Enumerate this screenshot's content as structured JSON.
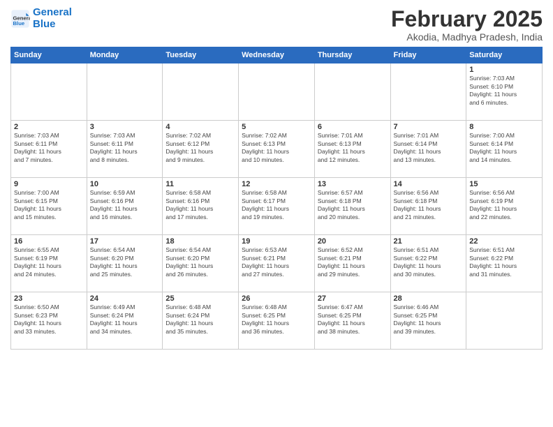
{
  "header": {
    "logo_line1": "General",
    "logo_line2": "Blue",
    "month": "February 2025",
    "location": "Akodia, Madhya Pradesh, India"
  },
  "weekdays": [
    "Sunday",
    "Monday",
    "Tuesday",
    "Wednesday",
    "Thursday",
    "Friday",
    "Saturday"
  ],
  "weeks": [
    [
      {
        "day": "",
        "info": ""
      },
      {
        "day": "",
        "info": ""
      },
      {
        "day": "",
        "info": ""
      },
      {
        "day": "",
        "info": ""
      },
      {
        "day": "",
        "info": ""
      },
      {
        "day": "",
        "info": ""
      },
      {
        "day": "1",
        "info": "Sunrise: 7:03 AM\nSunset: 6:10 PM\nDaylight: 11 hours\nand 6 minutes."
      }
    ],
    [
      {
        "day": "2",
        "info": "Sunrise: 7:03 AM\nSunset: 6:11 PM\nDaylight: 11 hours\nand 7 minutes."
      },
      {
        "day": "3",
        "info": "Sunrise: 7:03 AM\nSunset: 6:11 PM\nDaylight: 11 hours\nand 8 minutes."
      },
      {
        "day": "4",
        "info": "Sunrise: 7:02 AM\nSunset: 6:12 PM\nDaylight: 11 hours\nand 9 minutes."
      },
      {
        "day": "5",
        "info": "Sunrise: 7:02 AM\nSunset: 6:13 PM\nDaylight: 11 hours\nand 10 minutes."
      },
      {
        "day": "6",
        "info": "Sunrise: 7:01 AM\nSunset: 6:13 PM\nDaylight: 11 hours\nand 12 minutes."
      },
      {
        "day": "7",
        "info": "Sunrise: 7:01 AM\nSunset: 6:14 PM\nDaylight: 11 hours\nand 13 minutes."
      },
      {
        "day": "8",
        "info": "Sunrise: 7:00 AM\nSunset: 6:14 PM\nDaylight: 11 hours\nand 14 minutes."
      }
    ],
    [
      {
        "day": "9",
        "info": "Sunrise: 7:00 AM\nSunset: 6:15 PM\nDaylight: 11 hours\nand 15 minutes."
      },
      {
        "day": "10",
        "info": "Sunrise: 6:59 AM\nSunset: 6:16 PM\nDaylight: 11 hours\nand 16 minutes."
      },
      {
        "day": "11",
        "info": "Sunrise: 6:58 AM\nSunset: 6:16 PM\nDaylight: 11 hours\nand 17 minutes."
      },
      {
        "day": "12",
        "info": "Sunrise: 6:58 AM\nSunset: 6:17 PM\nDaylight: 11 hours\nand 19 minutes."
      },
      {
        "day": "13",
        "info": "Sunrise: 6:57 AM\nSunset: 6:18 PM\nDaylight: 11 hours\nand 20 minutes."
      },
      {
        "day": "14",
        "info": "Sunrise: 6:56 AM\nSunset: 6:18 PM\nDaylight: 11 hours\nand 21 minutes."
      },
      {
        "day": "15",
        "info": "Sunrise: 6:56 AM\nSunset: 6:19 PM\nDaylight: 11 hours\nand 22 minutes."
      }
    ],
    [
      {
        "day": "16",
        "info": "Sunrise: 6:55 AM\nSunset: 6:19 PM\nDaylight: 11 hours\nand 24 minutes."
      },
      {
        "day": "17",
        "info": "Sunrise: 6:54 AM\nSunset: 6:20 PM\nDaylight: 11 hours\nand 25 minutes."
      },
      {
        "day": "18",
        "info": "Sunrise: 6:54 AM\nSunset: 6:20 PM\nDaylight: 11 hours\nand 26 minutes."
      },
      {
        "day": "19",
        "info": "Sunrise: 6:53 AM\nSunset: 6:21 PM\nDaylight: 11 hours\nand 27 minutes."
      },
      {
        "day": "20",
        "info": "Sunrise: 6:52 AM\nSunset: 6:21 PM\nDaylight: 11 hours\nand 29 minutes."
      },
      {
        "day": "21",
        "info": "Sunrise: 6:51 AM\nSunset: 6:22 PM\nDaylight: 11 hours\nand 30 minutes."
      },
      {
        "day": "22",
        "info": "Sunrise: 6:51 AM\nSunset: 6:22 PM\nDaylight: 11 hours\nand 31 minutes."
      }
    ],
    [
      {
        "day": "23",
        "info": "Sunrise: 6:50 AM\nSunset: 6:23 PM\nDaylight: 11 hours\nand 33 minutes."
      },
      {
        "day": "24",
        "info": "Sunrise: 6:49 AM\nSunset: 6:24 PM\nDaylight: 11 hours\nand 34 minutes."
      },
      {
        "day": "25",
        "info": "Sunrise: 6:48 AM\nSunset: 6:24 PM\nDaylight: 11 hours\nand 35 minutes."
      },
      {
        "day": "26",
        "info": "Sunrise: 6:48 AM\nSunset: 6:25 PM\nDaylight: 11 hours\nand 36 minutes."
      },
      {
        "day": "27",
        "info": "Sunrise: 6:47 AM\nSunset: 6:25 PM\nDaylight: 11 hours\nand 38 minutes."
      },
      {
        "day": "28",
        "info": "Sunrise: 6:46 AM\nSunset: 6:25 PM\nDaylight: 11 hours\nand 39 minutes."
      },
      {
        "day": "",
        "info": ""
      }
    ]
  ]
}
